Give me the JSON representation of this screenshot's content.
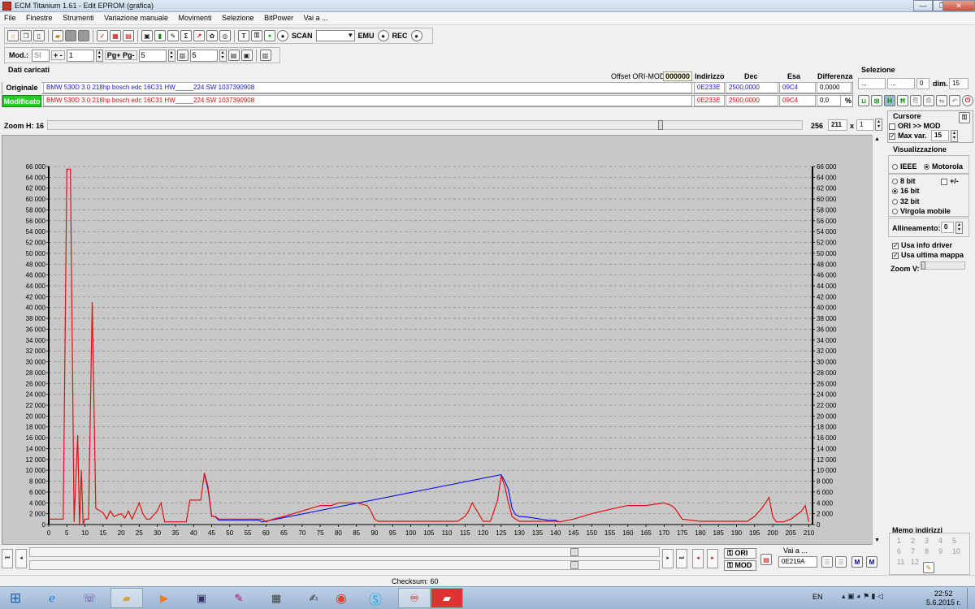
{
  "window": {
    "title": "ECM Titanium 1.61 - Edit EPROM (grafica)",
    "minimize": "—",
    "maximize": "❐",
    "close": "✕"
  },
  "menu": [
    "File",
    "Finestre",
    "Strumenti",
    "Variazione manuale",
    "Movimenti",
    "Selezione",
    "BitPower",
    "Vai a ..."
  ],
  "toolbar1": {
    "scan_label": "SCAN",
    "emu_label": "EMU",
    "rec_label": "REC"
  },
  "toolbar2": {
    "mod_label": "Mod.:",
    "mod_value": "SI",
    "plusminus_label": "+ -",
    "plusminus_value": "1",
    "pg_label": "Pg+ Pg-",
    "pg_value": "5",
    "col_value": "5"
  },
  "dati": {
    "section_title": "Dati caricati",
    "offset_label": "Offset ORI-MOD",
    "offset_value": "000000",
    "col_indirizzo": "Indirizzo",
    "col_dec": "Dec",
    "col_esa": "Esa",
    "col_differenza": "Differenza",
    "originale": {
      "label": "Originale",
      "desc": "BMW 530D 3.0 218hp bosch edc 16C31  HW_____224  SW 1037390908",
      "indirizzo": "0E233E",
      "dec": "2500,0000",
      "esa": "09C4",
      "differenza": "0,0000"
    },
    "modificato": {
      "label": "Modificato",
      "desc": "BMW 530D 3.0 218hp bosch edc 16C31  HW_____224  SW 1037390908",
      "indirizzo": "0E233E",
      "dec": "2500,0000",
      "esa": "09C4",
      "differenza": "0,0",
      "pct": "%"
    }
  },
  "selezione": {
    "title": "Selezione",
    "from": "...",
    "to": "...",
    "count": "0",
    "dim_label": "dim.",
    "dim_value": "15"
  },
  "zoom_h": {
    "label": "Zoom H: 16",
    "value_256": "256",
    "value_211": "211",
    "x_label": "x",
    "mult": "1"
  },
  "cursore": {
    "title": "Cursore",
    "ori_mod": "ORI >> MOD",
    "max_var": "Max var.",
    "max_var_value": "15"
  },
  "visualizzazione": {
    "title": "Visualizzazione",
    "ieee": "IEEE",
    "motorola": "Motorola",
    "bit8": "8 bit",
    "plusminus": "+/-",
    "bit16": "16 bit",
    "bit32": "32 bit",
    "virgola": "Virgola mobile",
    "allineamento_label": "Allineamento:",
    "allineamento_value": "0",
    "usa_info": "Usa info driver",
    "usa_ultima": "Usa ultima mappa",
    "zoom_v": "Zoom V:"
  },
  "memo": {
    "title": "Memo indirizzi",
    "numbers": [
      "1",
      "2",
      "3",
      "4",
      "5",
      "6",
      "7",
      "8",
      "9",
      "10",
      "11",
      "12"
    ]
  },
  "bottom": {
    "vai_a_label": "Vai a ...",
    "vai_a_value": "0E219A",
    "ori_btn": "ORI",
    "mod_btn": "MOD"
  },
  "status": {
    "checksum": "Checksum: 60"
  },
  "taskbar": {
    "lang": "EN",
    "time": "22:52",
    "date": "5.6.2015 г."
  },
  "chart_data": {
    "type": "line",
    "ylim": [
      0,
      66000
    ],
    "xlim": [
      0,
      211
    ],
    "y_ticks": [
      0,
      2000,
      4000,
      6000,
      8000,
      10000,
      12000,
      14000,
      16000,
      18000,
      20000,
      22000,
      24000,
      26000,
      28000,
      30000,
      32000,
      34000,
      36000,
      38000,
      40000,
      42000,
      44000,
      46000,
      48000,
      50000,
      52000,
      54000,
      56000,
      58000,
      60000,
      62000,
      64000,
      66000
    ],
    "y_tick_labels": [
      "0",
      "2 000",
      "4 000",
      "6 000",
      "8 000",
      "10 000",
      "12 000",
      "14 000",
      "16 000",
      "18 000",
      "20 000",
      "22 000",
      "24 000",
      "26 000",
      "28 000",
      "30 000",
      "32 000",
      "34 000",
      "36 000",
      "38 000",
      "40 000",
      "42 000",
      "44 000",
      "46 000",
      "48 000",
      "50 000",
      "52 000",
      "54 000",
      "56 000",
      "58 000",
      "60 000",
      "62 000",
      "64 000",
      "66 000"
    ],
    "x_ticks": [
      0,
      5,
      10,
      15,
      20,
      25,
      30,
      35,
      40,
      45,
      50,
      55,
      60,
      65,
      70,
      75,
      80,
      85,
      90,
      95,
      100,
      105,
      110,
      115,
      120,
      125,
      130,
      135,
      140,
      145,
      150,
      155,
      160,
      165,
      170,
      175,
      180,
      185,
      190,
      195,
      200,
      205,
      210
    ],
    "grid": true,
    "series": [
      {
        "color": "#1a1ae0",
        "x": [
          43,
          44,
          45,
          46,
          47,
          58,
          59,
          125,
          126,
          127,
          128,
          129,
          130,
          132,
          138,
          140,
          141
        ],
        "y": [
          9300,
          6500,
          1600,
          1400,
          800,
          800,
          500,
          9200,
          8000,
          6500,
          3000,
          1800,
          1500,
          1400,
          800,
          800,
          500
        ]
      },
      {
        "color": "#e01010",
        "x": [
          0,
          4,
          5,
          6,
          7,
          8,
          8.5,
          9,
          9.5,
          10,
          11,
          12,
          13,
          15,
          16,
          17,
          18,
          20,
          21,
          22,
          23,
          25,
          26,
          27,
          28,
          30,
          31,
          32,
          34,
          38,
          39,
          40,
          41,
          42,
          43,
          44,
          45,
          46,
          47,
          59,
          60,
          62,
          65,
          70,
          75,
          78,
          80,
          82,
          85,
          88,
          89,
          90,
          91,
          100,
          105,
          110,
          113,
          115,
          116,
          117,
          120,
          121,
          122,
          123,
          124,
          125,
          126,
          127,
          128,
          129,
          130,
          132,
          140,
          141,
          142,
          145,
          150,
          155,
          160,
          165,
          170,
          172,
          173,
          175,
          180,
          185,
          190,
          193,
          195,
          197,
          198,
          199,
          200,
          201,
          203,
          205,
          208,
          209,
          210
        ],
        "y": [
          1000,
          1000,
          65500,
          65500,
          500,
          16500,
          0,
          10000,
          0,
          1000,
          1000,
          41000,
          3000,
          2200,
          1000,
          2500,
          1500,
          2000,
          1200,
          2500,
          1000,
          4000,
          2000,
          1000,
          1000,
          2500,
          4000,
          500,
          500,
          500,
          4500,
          4500,
          4500,
          4500,
          9500,
          7000,
          1500,
          1500,
          1000,
          1000,
          500,
          1000,
          1500,
          2500,
          3500,
          3500,
          4000,
          4000,
          4000,
          3500,
          2500,
          1000,
          600,
          600,
          600,
          600,
          600,
          1500,
          2500,
          4000,
          600,
          600,
          600,
          2500,
          4500,
          9000,
          7000,
          4000,
          1500,
          1000,
          600,
          600,
          600,
          500,
          600,
          1000,
          2000,
          2800,
          3500,
          3500,
          4000,
          3500,
          3000,
          1000,
          600,
          600,
          600,
          600,
          1500,
          3000,
          4000,
          5000,
          1500,
          500,
          500,
          1000,
          2500,
          3500,
          500
        ]
      }
    ]
  }
}
